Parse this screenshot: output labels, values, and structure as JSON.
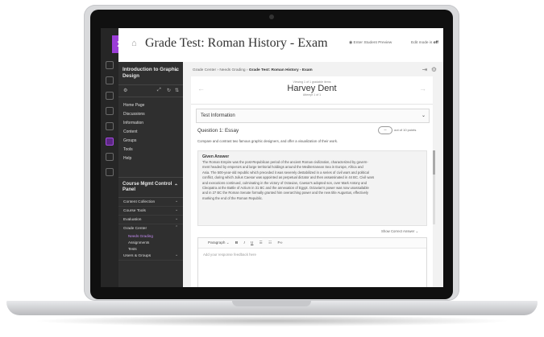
{
  "header": {
    "title": "Grade Test: Roman History - Exam",
    "student_preview": "Enter Student Preview",
    "edit_mode_label": "Edit mode is",
    "edit_mode_value": "off"
  },
  "nav": {
    "course_title": "Introduction to Graphic Design",
    "menu": [
      "Home Page",
      "Discussions",
      "Information",
      "Content",
      "Groups",
      "Tools",
      "Help"
    ],
    "panel_title": "Course Mgmt Control Panel",
    "sections": [
      "Content Collection",
      "Course Tools",
      "Evaluation",
      "Grade Center"
    ],
    "grade_children": [
      "Needs Grading",
      "Assignments",
      "Tests"
    ],
    "users": "Users & Groups"
  },
  "breadcrumb": {
    "part1": "Grade Center",
    "part2": "Needs Grading",
    "current": "Grade Test: Roman History - Exam"
  },
  "student": {
    "viewing": "Viewing 1 of 1 gradable items",
    "name": "Harvey Dent",
    "attempt": "Attempt 1 of 1"
  },
  "test_info": "Test Information",
  "question": {
    "title": "Question 1: Essay",
    "score_value": "--",
    "points": "out of 10 points",
    "prompt": "Compare and contrast two famous graphic designers, and offer a visualization of their work.",
    "answer_heading": "Given Answer",
    "answer_lines": [
      "The Roman Empire was the post-Republican period of the ancient Roman civilization, characterized by govern-",
      "ment headed by emperors and large territorial holdings around the Mediterranean Sea in Europe, Africa and",
      "Asia. The 500-year-old republic which preceded it was severely destabilized in a series of civil wars and political",
      "conflict, during which Julius Caesar was appointed as perpetual dictator and then assassinated in 44 BC. Civil wars",
      "and executions continued, culminating in the victory of Octavian, Caesar's adopted son, over Mark Antony and",
      "Cleopatra at the Battle of Actium in 31 BC and the annexation of Egypt. Octavian's power was now unassailable",
      "and in 27 BC the Roman Senate formally granted him overarching power and the new title Augustus, effectively",
      "marking the end of the Roman Republic."
    ],
    "show_correct": "Show Correct Answer"
  },
  "editor": {
    "paragraph": "Paragraph",
    "bold": "B",
    "italic": "I",
    "underline": "U",
    "placeholder": "Add your response feedback here"
  }
}
